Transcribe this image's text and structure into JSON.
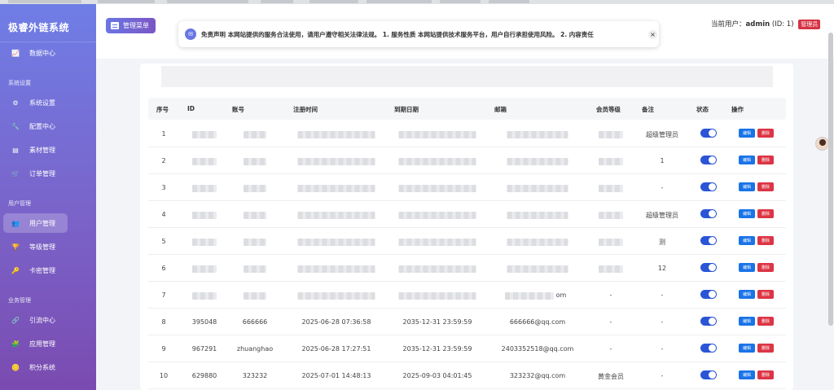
{
  "sidebar": {
    "logo": "极睿外链系统",
    "sections": {
      "system": "系统设置",
      "users": "用户管理",
      "business": "业务管理"
    },
    "items": {
      "dashboard": "数据中心",
      "sys_settings": "系统设置",
      "config": "配置中心",
      "materials": "素材管理",
      "orders": "订单管理",
      "user_mgmt": "用户管理",
      "level_mgmt": "等级管理",
      "card_mgmt": "卡密管理",
      "traffic": "引流中心",
      "apps": "应用管理",
      "points": "积分系统"
    }
  },
  "header": {
    "menu_button": "管理菜单",
    "notice": "免责声明 本网站提供的服务合法使用，请用户遵守相关法律法规。 1. 服务性质 本网站提供技术服务平台，用户自行承担使用风险。 2. 内容责任",
    "close": "×",
    "user_label": "当前用户：",
    "username": "admin",
    "user_id": "(ID: 1)",
    "role_badge": "管理员"
  },
  "table": {
    "columns": {
      "index": "序号",
      "id": "ID",
      "account": "账号",
      "reg_time": "注册时间",
      "expire": "到期日期",
      "email": "邮箱",
      "level": "会员等级",
      "note": "备注",
      "status": "状态",
      "actions": "操作"
    },
    "edit_label": "编辑",
    "delete_label": "删除",
    "rows": [
      {
        "index": "1",
        "note": "超级管理员"
      },
      {
        "index": "2",
        "note": "1"
      },
      {
        "index": "3",
        "note": "-"
      },
      {
        "index": "4",
        "note": "超级管理员"
      },
      {
        "index": "5",
        "note": "测"
      },
      {
        "index": "6",
        "note": "12"
      },
      {
        "index": "7",
        "email_tail": "om",
        "level": "-",
        "note": "-"
      },
      {
        "index": "8",
        "id": "395048",
        "account": "666666",
        "reg_time": "2025-06-28 07:36:58",
        "expire": "2035-12-31 23:59:59",
        "email": "666666@qq.com",
        "level": "-",
        "note": "-"
      },
      {
        "index": "9",
        "id": "967291",
        "account": "zhuanghao",
        "reg_time": "2025-06-28 17:27:51",
        "expire": "2035-12-31 23:59:59",
        "email": "2403352518@qq.com",
        "level": "-",
        "note": "-"
      },
      {
        "index": "10",
        "id": "629880",
        "account": "323232",
        "reg_time": "2025-07-01 14:48:13",
        "expire": "2025-09-03 04:01:45",
        "email": "323232@qq.com",
        "level": "黄金会员",
        "note": "-"
      }
    ]
  },
  "colors": {
    "accent": "#6a76e4",
    "toggle": "#2a55d6",
    "edit": "#1a73e8",
    "delete": "#dc3545",
    "badge": "#d63344"
  },
  "icons": {
    "dashboard": "chart-line-icon",
    "settings": "gear-icon",
    "config": "wrench-icon",
    "materials": "file-icon",
    "orders": "cart-icon",
    "users": "users-icon",
    "levels": "trophy-icon",
    "cards": "key-icon",
    "traffic": "link-icon",
    "apps": "puzzle-icon",
    "points": "coins-icon",
    "notice": "bell-icon"
  }
}
